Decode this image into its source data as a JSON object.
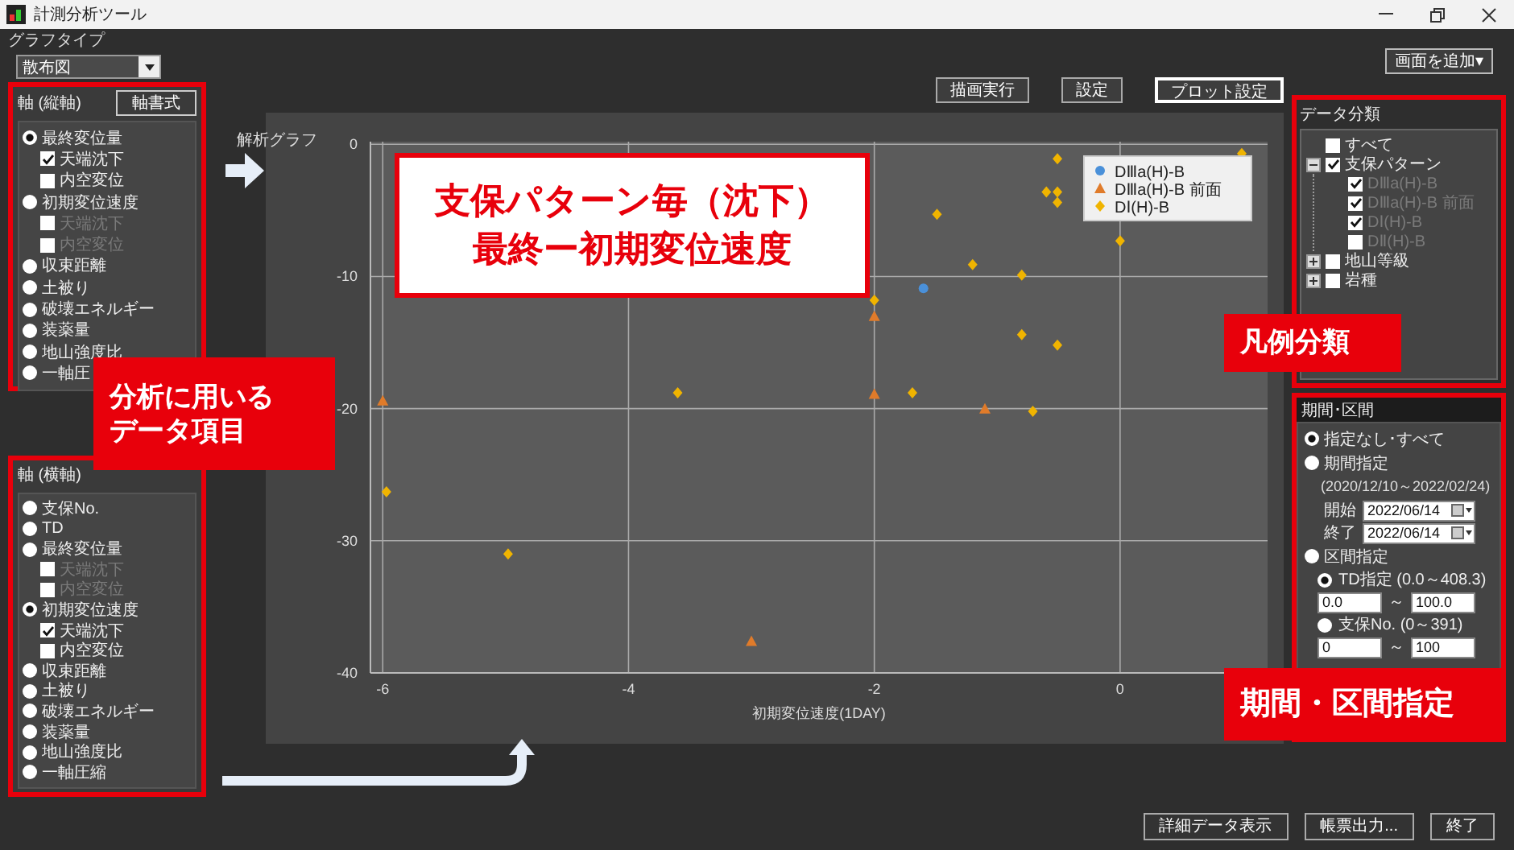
{
  "window": {
    "title": "計測分析ツール"
  },
  "graph_type": {
    "label": "グラフタイプ",
    "value": "散布図"
  },
  "y_axis_panel": {
    "title": "軸 (縦軸)",
    "format_button": "軸書式",
    "items": [
      {
        "kind": "radio",
        "label": "最終変位量",
        "selected": true,
        "children": [
          {
            "kind": "checkbox",
            "label": "天端沈下",
            "checked": true,
            "disabled": false
          },
          {
            "kind": "checkbox",
            "label": "内空変位",
            "checked": false,
            "disabled": false
          }
        ]
      },
      {
        "kind": "radio",
        "label": "初期変位速度",
        "selected": false,
        "children": [
          {
            "kind": "checkbox",
            "label": "天端沈下",
            "checked": false,
            "disabled": true
          },
          {
            "kind": "checkbox",
            "label": "内空変位",
            "checked": false,
            "disabled": true
          }
        ]
      },
      {
        "kind": "radio",
        "label": "収束距離",
        "selected": false
      },
      {
        "kind": "radio",
        "label": "土被り",
        "selected": false
      },
      {
        "kind": "radio",
        "label": "破壊エネルギー",
        "selected": false
      },
      {
        "kind": "radio",
        "label": "装薬量",
        "selected": false
      },
      {
        "kind": "radio",
        "label": "地山強度比",
        "selected": false
      },
      {
        "kind": "radio",
        "label": "一軸圧",
        "selected": false
      }
    ]
  },
  "x_axis_panel": {
    "title": "軸 (横軸)",
    "items": [
      {
        "kind": "radio",
        "label": "支保No.",
        "selected": false
      },
      {
        "kind": "radio",
        "label": "TD",
        "selected": false
      },
      {
        "kind": "radio",
        "label": "最終変位量",
        "selected": false,
        "children": [
          {
            "kind": "checkbox",
            "label": "天端沈下",
            "checked": false,
            "disabled": true
          },
          {
            "kind": "checkbox",
            "label": "内空変位",
            "checked": false,
            "disabled": true
          }
        ]
      },
      {
        "kind": "radio",
        "label": "初期変位速度",
        "selected": true,
        "children": [
          {
            "kind": "checkbox",
            "label": "天端沈下",
            "checked": true,
            "disabled": false
          },
          {
            "kind": "checkbox",
            "label": "内空変位",
            "checked": false,
            "disabled": false
          }
        ]
      },
      {
        "kind": "radio",
        "label": "収束距離",
        "selected": false
      },
      {
        "kind": "radio",
        "label": "土被り",
        "selected": false
      },
      {
        "kind": "radio",
        "label": "破壊エネルギー",
        "selected": false
      },
      {
        "kind": "radio",
        "label": "装薬量",
        "selected": false
      },
      {
        "kind": "radio",
        "label": "地山強度比",
        "selected": false
      },
      {
        "kind": "radio",
        "label": "一軸圧縮",
        "selected": false
      }
    ]
  },
  "toolbar": [
    {
      "label": "描画実行",
      "focused": false
    },
    {
      "label": "設定",
      "focused": false
    },
    {
      "label": "プロット設定",
      "focused": true
    }
  ],
  "chart": {
    "title": "解析グラフ",
    "chart_data": {
      "type": "scatter",
      "xlabel": "初期変位速度(1DAY)",
      "xlim": [
        -6.1,
        1.2
      ],
      "ylim": [
        -40,
        0.2
      ],
      "xticks": [
        -6,
        -4,
        -2,
        0
      ],
      "yticks": [
        0,
        -10,
        -20,
        -30,
        -40
      ],
      "grid": true,
      "legend": true,
      "series": [
        {
          "name": "DⅢa(H)-B",
          "color": "#4a90d9",
          "x": [
            -1.6
          ],
          "values": [
            -10.9
          ]
        },
        {
          "name": "DⅢa(H)-B 前面",
          "color": "#e07b2a",
          "x": [
            -6,
            -2,
            -2,
            -1.1,
            -3
          ],
          "values": [
            -19.4,
            -13,
            -18.9,
            -20,
            -37.6
          ]
        },
        {
          "name": "DⅠ(H)-B",
          "color": "#f0b400",
          "x": [
            0.99,
            -0.51,
            -0.6,
            -0.51,
            -0.51,
            -1.49,
            0,
            -1.2,
            -0.8,
            -2,
            -0.8,
            -0.51,
            -3.6,
            -1.69,
            -0.71,
            -5.97,
            -4.98
          ],
          "values": [
            -0.7,
            -1.1,
            -3.6,
            -3.6,
            -4.4,
            -5.3,
            -7.3,
            -9.1,
            -9.9,
            -11.8,
            -14.4,
            -15.2,
            -18.8,
            -18.8,
            -20.2,
            -26.3,
            -31
          ]
        }
      ]
    }
  },
  "add_screen_button": "画面を追加▾",
  "data_panel": {
    "title": "データ分類",
    "tree": [
      {
        "label": "すべて",
        "checked": false
      },
      {
        "label": "支保パターン",
        "checked": true,
        "expanded": true,
        "children": [
          {
            "label": "DⅢa(H)-B",
            "checked": true,
            "disabled": true
          },
          {
            "label": "DⅢa(H)-B 前面",
            "checked": true,
            "disabled": true
          },
          {
            "label": "DⅠ(H)-B",
            "checked": true,
            "disabled": true
          },
          {
            "label": "DⅡ(H)-B",
            "checked": false,
            "disabled": true
          }
        ]
      },
      {
        "label": "地山等級",
        "checked": false,
        "expanded": false
      },
      {
        "label": "岩種",
        "checked": false,
        "expanded": false
      }
    ]
  },
  "period_panel": {
    "title": "期間･区間",
    "all_option": {
      "label": "指定なし･すべて",
      "selected": true
    },
    "period_option": {
      "label": "期間指定",
      "selected": false,
      "range_note": "(2020/12/10～2022/02/24)",
      "start": {
        "label": "開始",
        "value": "2022/06/14"
      },
      "end": {
        "label": "終了",
        "value": "2022/06/14"
      }
    },
    "section_option": {
      "label": "区間指定",
      "selected": false,
      "sub_options": [
        {
          "label": "TD指定 (0.0～408.3)",
          "selected": true,
          "from": "0.0",
          "separator": "～",
          "to": "100.0"
        },
        {
          "label": "支保No. (0～391)",
          "selected": false,
          "from": "0",
          "separator": "～",
          "to": "100"
        }
      ]
    }
  },
  "footer_buttons": [
    "詳細データ表示",
    "帳票出力...",
    "終了"
  ],
  "annotations": {
    "chart_title": [
      "支保パターン毎（沈下）",
      "最終ー初期変位速度"
    ],
    "data_items": [
      "分析に用いる",
      "データ項目"
    ],
    "legend_class": "凡例分類",
    "period_spec": "期間・区間指定"
  }
}
